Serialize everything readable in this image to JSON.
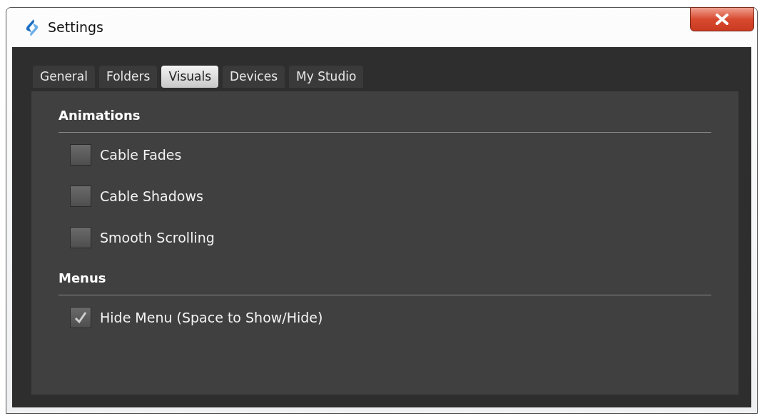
{
  "window": {
    "title": "Settings"
  },
  "tabs": [
    {
      "label": "General",
      "selected": false
    },
    {
      "label": "Folders",
      "selected": false
    },
    {
      "label": "Visuals",
      "selected": true
    },
    {
      "label": "Devices",
      "selected": false
    },
    {
      "label": "My Studio",
      "selected": false
    }
  ],
  "sections": [
    {
      "title": "Animations",
      "options": [
        {
          "label": "Cable Fades",
          "checked": false
        },
        {
          "label": "Cable Shadows",
          "checked": false
        },
        {
          "label": "Smooth Scrolling",
          "checked": false
        }
      ]
    },
    {
      "title": "Menus",
      "options": [
        {
          "label": "Hide Menu (Space to Show/Hide)",
          "checked": true
        }
      ]
    }
  ]
}
